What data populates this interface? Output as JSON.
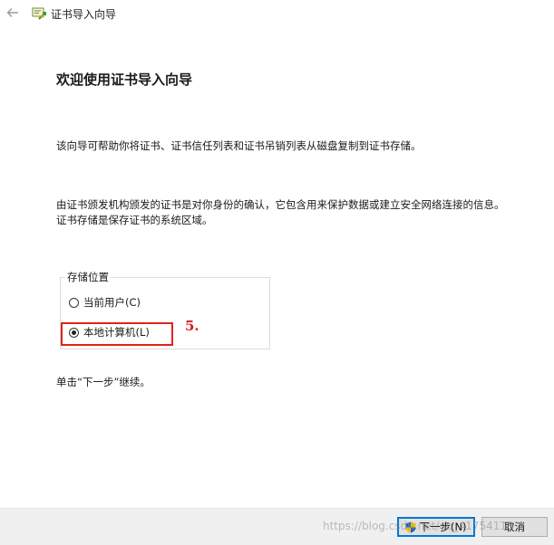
{
  "window": {
    "title": "证书导入向导"
  },
  "wizard": {
    "heading": "欢迎使用证书导入向导",
    "para1": "该向导可帮助你将证书、证书信任列表和证书吊销列表从磁盘复制到证书存储。",
    "para2": "由证书颁发机构颁发的证书是对你身份的确认，它包含用来保护数据或建立安全网络连接的信息。证书存储是保存证书的系统区域。",
    "store_location": {
      "label": "存储位置",
      "options": [
        {
          "label": "当前用户(C)",
          "selected": false
        },
        {
          "label": "本地计算机(L)",
          "selected": true
        }
      ]
    },
    "para3": "单击“下一步”继续。"
  },
  "annotation": {
    "step": "5."
  },
  "footer": {
    "next_label": "下一步(N)",
    "cancel_label": "取消"
  },
  "watermark": "https://blog.csdn.net/qq_41754118",
  "colors": {
    "highlight_red": "#e0241b",
    "focus_blue": "#0078d7"
  },
  "icons": {
    "back": "back-arrow-icon",
    "app": "certificate-icon",
    "uac": "uac-shield-icon"
  }
}
